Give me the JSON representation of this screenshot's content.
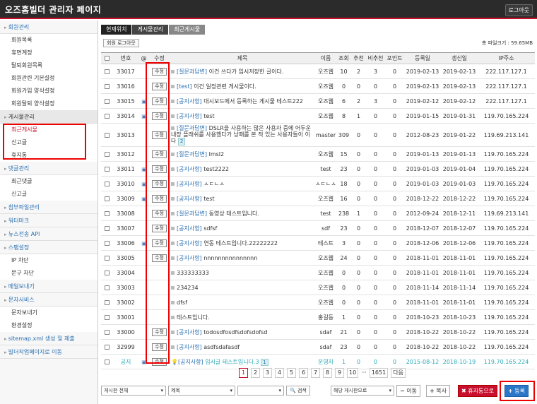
{
  "header": {
    "title": "오즈홈빌더 관리자 페이지",
    "logout": "로그아웃"
  },
  "sidebar": [
    {
      "label": "회원관리",
      "type": "main"
    },
    {
      "label": "회원목록",
      "type": "sub"
    },
    {
      "label": "휴면계정",
      "type": "sub"
    },
    {
      "label": "탈퇴회원목록",
      "type": "sub"
    },
    {
      "label": "회원관련 기본설정",
      "type": "sub"
    },
    {
      "label": "회원가입 양식설정",
      "type": "sub"
    },
    {
      "label": "회원탈퇴 양식설정",
      "type": "sub"
    },
    {
      "label": "게시물관리",
      "type": "main",
      "active": true
    },
    {
      "label": "최근게시물",
      "type": "sub",
      "highlight": true
    },
    {
      "label": "신고글",
      "type": "sub"
    },
    {
      "label": "휴지통",
      "type": "sub"
    },
    {
      "label": "댓글관리",
      "type": "main"
    },
    {
      "label": "최근댓글",
      "type": "sub"
    },
    {
      "label": "신고글",
      "type": "sub"
    },
    {
      "label": "첨부파일관리",
      "type": "main"
    },
    {
      "label": "워터마크",
      "type": "main"
    },
    {
      "label": "뉴스전송 API",
      "type": "main"
    },
    {
      "label": "스팸설정",
      "type": "main"
    },
    {
      "label": "IP 차단",
      "type": "sub"
    },
    {
      "label": "문구 차단",
      "type": "sub"
    },
    {
      "label": "메일보내기",
      "type": "main"
    },
    {
      "label": "문자서비스",
      "type": "main"
    },
    {
      "label": "문자보내기",
      "type": "sub"
    },
    {
      "label": "환경설정",
      "type": "sub"
    },
    {
      "label": "sitemap.xml 생성 및 제출",
      "type": "main"
    },
    {
      "label": "빌더작업페이지로 이동",
      "type": "main"
    }
  ],
  "breadcrumb": [
    "현재위치",
    "게시물관리",
    "최근게시물"
  ],
  "login_button": "회원 로그아웃",
  "file_size": "총 파일크기 : 59.65MB",
  "columns": [
    "",
    "번호",
    "@",
    "수정",
    "제목",
    "이름",
    "조회",
    "추천",
    "비추천",
    "포인트",
    "등록일",
    "갱신일",
    "IP주소"
  ],
  "edit_label": "수정",
  "rows": [
    {
      "no": "33017",
      "att": false,
      "edit": true,
      "cat": "[질문과답변]",
      "title": "이건 쓰다가 임시저장한 글이다.",
      "name": "오즈웹",
      "views": "10",
      "up": "2",
      "down": "3",
      "pts": "0",
      "reg": "2019-02-13",
      "upd": "2019-02-13",
      "ip": "222.117.127.1"
    },
    {
      "no": "33016",
      "att": false,
      "edit": true,
      "cat": "[test]",
      "title": "이건 일정관련 게시물이다.",
      "name": "오즈웹",
      "views": "0",
      "up": "0",
      "down": "0",
      "pts": "0",
      "reg": "2019-02-13",
      "upd": "2019-02-13",
      "ip": "222.117.127.1"
    },
    {
      "no": "33015",
      "att": true,
      "edit": true,
      "cat": "[공지사항]",
      "title": "대시보드에서 등록하는 게시물 테스트222",
      "name": "오즈웹",
      "views": "6",
      "up": "2",
      "down": "3",
      "pts": "0",
      "reg": "2019-02-12",
      "upd": "2019-02-12",
      "ip": "222.117.127.1"
    },
    {
      "no": "33014",
      "att": true,
      "edit": true,
      "cat": "[공지사항]",
      "title": "test",
      "name": "오즈웹",
      "views": "8",
      "up": "1",
      "down": "0",
      "pts": "0",
      "reg": "2019-01-15",
      "upd": "2019-01-31",
      "ip": "119.70.165.224"
    },
    {
      "no": "33013",
      "att": false,
      "edit": true,
      "tall": true,
      "cat": "[질문과답변]",
      "title": "DSLR을 사용하는 많은 사용자 중에 어두운 내장 플래쉬를 사용했다가 낭패를 본 적 있는 사용자들이 이다",
      "badge": "2",
      "name": "master",
      "views": "309",
      "up": "0",
      "down": "0",
      "pts": "0",
      "reg": "2012-08-23",
      "upd": "2019-01-22",
      "ip": "119.69.213.141"
    },
    {
      "no": "33012",
      "att": false,
      "edit": true,
      "cat": "[질문과답변]",
      "title": "lmsl2",
      "name": "오즈웹",
      "views": "15",
      "up": "0",
      "down": "0",
      "pts": "0",
      "reg": "2019-01-13",
      "upd": "2019-01-13",
      "ip": "119.70.165.224"
    },
    {
      "no": "33011",
      "att": true,
      "edit": true,
      "cat": "[공지사항]",
      "title": "test2222",
      "name": "test",
      "views": "23",
      "up": "0",
      "down": "0",
      "pts": "0",
      "reg": "2019-01-03",
      "upd": "2019-01-04",
      "ip": "119.70.165.224"
    },
    {
      "no": "33010",
      "att": true,
      "edit": true,
      "cat": "[공지사항]",
      "title": "ㅅㄷㄴㅅ",
      "name": "ㅅㄷㄴㅅ",
      "views": "18",
      "up": "0",
      "down": "0",
      "pts": "0",
      "reg": "2019-01-03",
      "upd": "2019-01-03",
      "ip": "119.70.165.224"
    },
    {
      "no": "33009",
      "att": true,
      "edit": true,
      "cat": "[공지사항]",
      "title": "test",
      "name": "오즈웹",
      "views": "16",
      "up": "0",
      "down": "0",
      "pts": "0",
      "reg": "2018-12-22",
      "upd": "2018-12-22",
      "ip": "119.70.165.224"
    },
    {
      "no": "33008",
      "att": false,
      "edit": true,
      "cat": "[질문과답변]",
      "title": "동영상 테스트입니다.",
      "name": "test",
      "views": "238",
      "up": "1",
      "down": "0",
      "pts": "0",
      "reg": "2012-09-24",
      "upd": "2018-12-11",
      "ip": "119.69.213.141"
    },
    {
      "no": "33007",
      "att": false,
      "edit": true,
      "cat": "[공지사항]",
      "title": "sdfsf",
      "name": "sdf",
      "views": "23",
      "up": "0",
      "down": "0",
      "pts": "0",
      "reg": "2018-12-07",
      "upd": "2018-12-07",
      "ip": "119.70.165.224"
    },
    {
      "no": "33006",
      "att": true,
      "edit": true,
      "cat": "[공지사항]",
      "title": "연동 테스트입니다.22222222",
      "name": "테스트",
      "views": "3",
      "up": "0",
      "down": "0",
      "pts": "0",
      "reg": "2018-12-06",
      "upd": "2018-12-06",
      "ip": "119.70.165.224"
    },
    {
      "no": "33005",
      "att": false,
      "edit": true,
      "cat": "[공지사항]",
      "title": "nnnnnnnnnnnnnnn",
      "name": "오즈웹",
      "views": "24",
      "up": "0",
      "down": "0",
      "pts": "0",
      "reg": "2018-11-01",
      "upd": "2018-11-01",
      "ip": "119.70.165.224"
    },
    {
      "no": "33004",
      "att": false,
      "edit": false,
      "cat": "",
      "title": "333333333",
      "name": "오즈웹",
      "views": "0",
      "up": "0",
      "down": "0",
      "pts": "0",
      "reg": "2018-11-01",
      "upd": "2018-11-01",
      "ip": "119.70.165.224"
    },
    {
      "no": "33003",
      "att": false,
      "edit": false,
      "cat": "",
      "title": "234234",
      "name": "오즈웹",
      "views": "0",
      "up": "0",
      "down": "0",
      "pts": "0",
      "reg": "2018-11-14",
      "upd": "2018-11-14",
      "ip": "119.70.165.224"
    },
    {
      "no": "33002",
      "att": false,
      "edit": false,
      "cat": "",
      "title": "dfsf",
      "name": "오즈웹",
      "views": "0",
      "up": "0",
      "down": "0",
      "pts": "0",
      "reg": "2018-11-01",
      "upd": "2018-11-01",
      "ip": "119.70.165.224"
    },
    {
      "no": "33001",
      "att": false,
      "edit": false,
      "cat": "",
      "title": "테스트입니다.",
      "name": "홍길동",
      "views": "1",
      "up": "0",
      "down": "0",
      "pts": "0",
      "reg": "2018-10-23",
      "upd": "2018-10-23",
      "ip": "119.70.165.224"
    },
    {
      "no": "33000",
      "att": false,
      "edit": true,
      "cat": "[공지사항]",
      "title": "todosdfosdfsdofsdofsd",
      "name": "sdaf",
      "views": "21",
      "up": "0",
      "down": "0",
      "pts": "0",
      "reg": "2018-10-22",
      "upd": "2018-10-22",
      "ip": "119.70.165.224"
    },
    {
      "no": "32999",
      "att": false,
      "edit": true,
      "cat": "[공지사항]",
      "title": "asdfsdafasdf",
      "name": "sdaf",
      "views": "23",
      "up": "0",
      "down": "0",
      "pts": "0",
      "reg": "2018-10-22",
      "upd": "2018-10-22",
      "ip": "119.70.165.224"
    },
    {
      "no": "공지",
      "att": true,
      "edit": true,
      "notice": true,
      "cat": "[공지사항]",
      "title": "임시글 테스트입니다.3",
      "badge": "1",
      "name": "운영자",
      "views": "1",
      "up": "0",
      "down": "0",
      "pts": "0",
      "reg": "2015-08-12",
      "upd": "2018-10-19",
      "ip": "119.70.165.224"
    }
  ],
  "pager": {
    "pages": [
      "1",
      "2",
      "3",
      "4",
      "5",
      "6",
      "7",
      "8",
      "9",
      "10"
    ],
    "current": "1",
    "dots": "···",
    "last": "1651",
    "next": "다음"
  },
  "bottom": {
    "board_select": "게시판 전체",
    "field_select": "제목",
    "search_value": "",
    "search_btn": "검색",
    "move_select": "해당 게시판으로",
    "move_btn": "이동",
    "copy_btn": "복사",
    "trash_btn": "휴지통으로",
    "register_btn": "등록"
  }
}
